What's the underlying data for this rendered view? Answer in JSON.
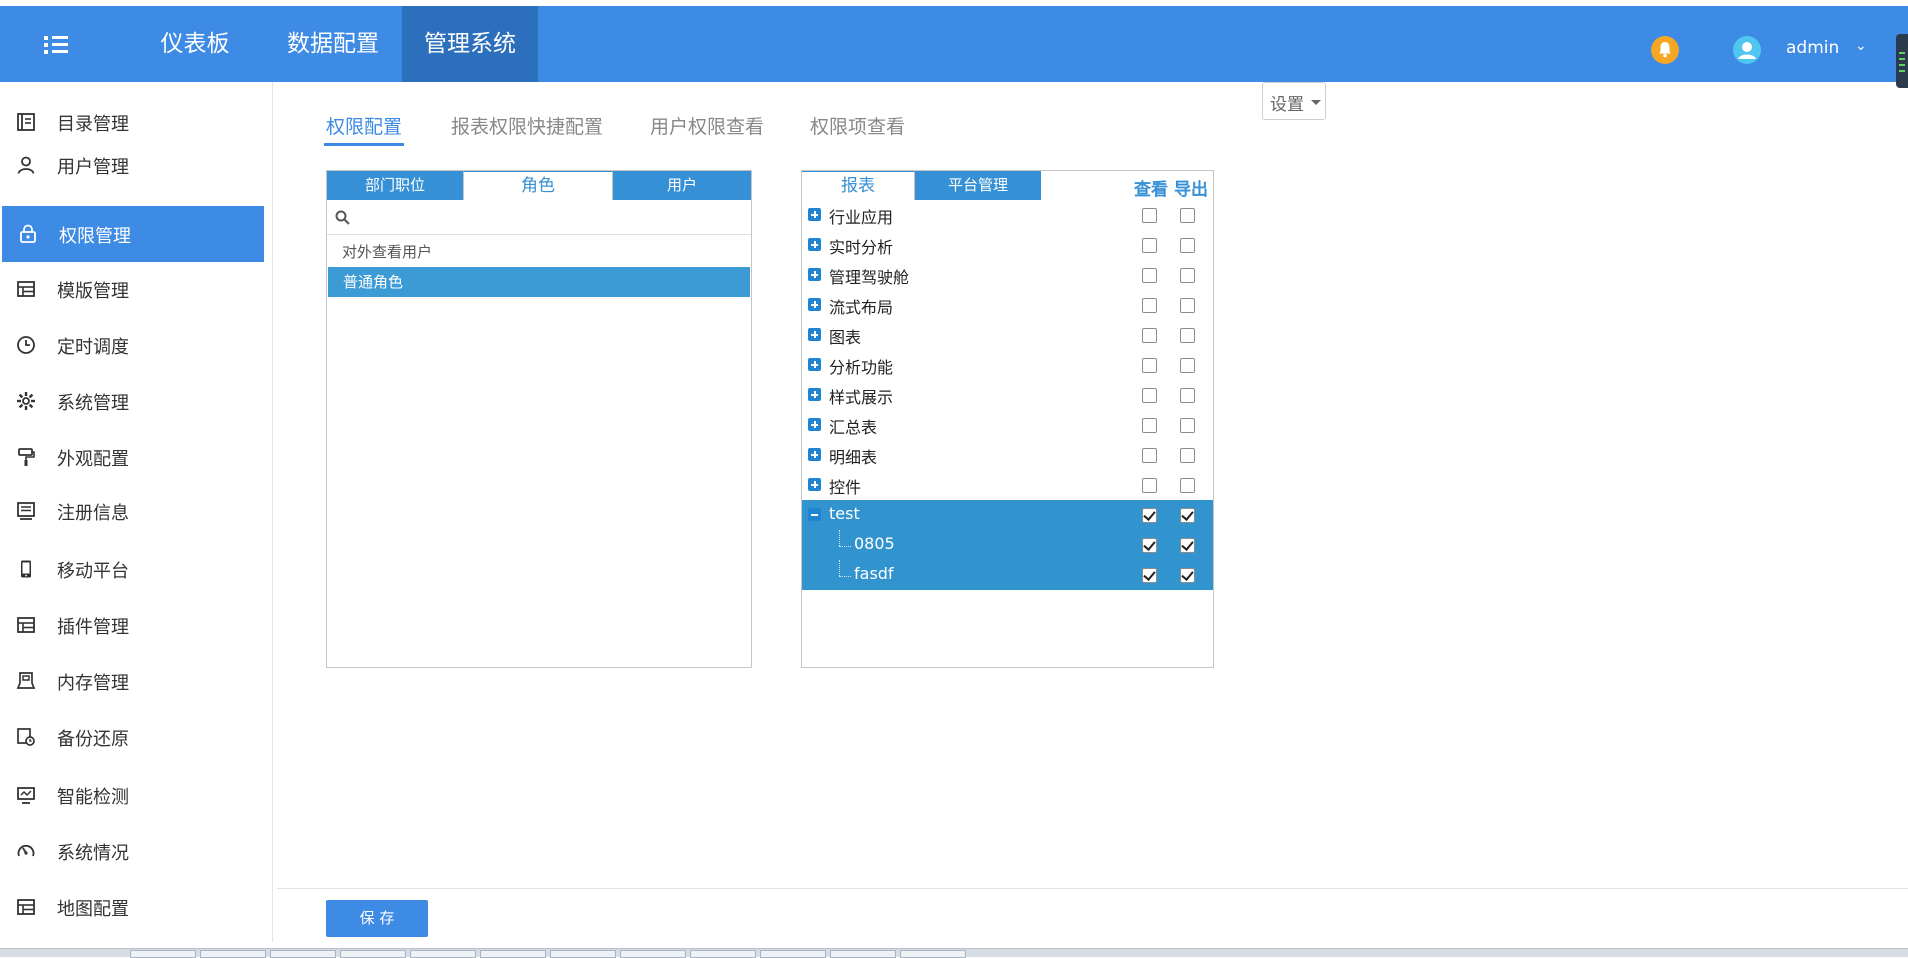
{
  "topbar": {
    "nav_tabs": [
      {
        "label": "仪表板",
        "active": false
      },
      {
        "label": "数据配置",
        "active": false
      },
      {
        "label": "管理系统",
        "active": true
      }
    ],
    "username": "admin",
    "accent_color": "#3d8be4"
  },
  "sidebar": {
    "items": [
      {
        "label": "目录管理",
        "icon": "catalog-icon"
      },
      {
        "label": "用户管理",
        "icon": "user-icon"
      },
      {
        "label": "权限管理",
        "icon": "lock-icon",
        "active": true
      },
      {
        "label": "模版管理",
        "icon": "template-icon"
      },
      {
        "label": "定时调度",
        "icon": "clock-icon"
      },
      {
        "label": "系统管理",
        "icon": "gear-icon"
      },
      {
        "label": "外观配置",
        "icon": "paint-roller-icon"
      },
      {
        "label": "注册信息",
        "icon": "register-icon"
      },
      {
        "label": "移动平台",
        "icon": "mobile-icon"
      },
      {
        "label": "插件管理",
        "icon": "plugin-icon"
      },
      {
        "label": "内存管理",
        "icon": "memory-icon"
      },
      {
        "label": "备份还原",
        "icon": "backup-icon"
      },
      {
        "label": "智能检测",
        "icon": "monitor-icon"
      },
      {
        "label": "系统情况",
        "icon": "gauge-icon"
      },
      {
        "label": "地图配置",
        "icon": "map-icon"
      }
    ]
  },
  "subtabs": [
    {
      "label": "权限配置",
      "active": true
    },
    {
      "label": "报表权限快捷配置",
      "active": false
    },
    {
      "label": "用户权限查看",
      "active": false
    },
    {
      "label": "权限项查看",
      "active": false
    }
  ],
  "settings": {
    "label": "设置"
  },
  "left_panel": {
    "tabs": [
      {
        "label": "部门职位",
        "selected": false
      },
      {
        "label": "角色",
        "selected": true
      },
      {
        "label": "用户",
        "selected": false
      }
    ],
    "search_placeholder": "",
    "roles": [
      {
        "label": "对外查看用户",
        "selected": false
      },
      {
        "label": "普通角色",
        "selected": true
      }
    ]
  },
  "right_panel": {
    "tabs": [
      {
        "label": "报表",
        "selected": true
      },
      {
        "label": "平台管理",
        "selected": false
      }
    ],
    "columns": {
      "view": "查看",
      "export": "导出"
    },
    "tree": [
      {
        "name": "行业应用",
        "expanded": false,
        "view": false,
        "export": false
      },
      {
        "name": "实时分析",
        "expanded": false,
        "view": false,
        "export": false
      },
      {
        "name": "管理驾驶舱",
        "expanded": false,
        "view": false,
        "export": false
      },
      {
        "name": "流式布局",
        "expanded": false,
        "view": false,
        "export": false
      },
      {
        "name": "图表",
        "expanded": false,
        "view": false,
        "export": false
      },
      {
        "name": "分析功能",
        "expanded": false,
        "view": false,
        "export": false
      },
      {
        "name": "样式展示",
        "expanded": false,
        "view": false,
        "export": false
      },
      {
        "name": "汇总表",
        "expanded": false,
        "view": false,
        "export": false
      },
      {
        "name": "明细表",
        "expanded": false,
        "view": false,
        "export": false
      },
      {
        "name": "控件",
        "expanded": false,
        "view": false,
        "export": false
      },
      {
        "name": "test",
        "expanded": true,
        "view": true,
        "export": true,
        "selected": true
      },
      {
        "name": "0805",
        "child": true,
        "view": true,
        "export": true,
        "selected": true
      },
      {
        "name": "fasdf",
        "child": true,
        "view": true,
        "export": true,
        "selected": true
      }
    ]
  },
  "save_label": "保 存"
}
